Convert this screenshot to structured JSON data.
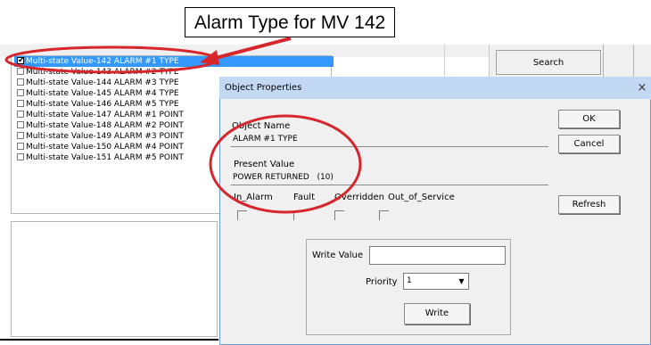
{
  "callout": {
    "text": "Alarm Type for MV 142"
  },
  "search": {
    "label": "Search"
  },
  "object_list": [
    {
      "label": "Multi-state Value-142 ALARM #1 TYPE",
      "checked": true,
      "selected": true
    },
    {
      "label": "Multi-state Value-143 ALARM #2 TYPE",
      "checked": false,
      "selected": false
    },
    {
      "label": "Multi-state Value-144 ALARM #3 TYPE",
      "checked": false,
      "selected": false
    },
    {
      "label": "Multi-state Value-145 ALARM #4 TYPE",
      "checked": false,
      "selected": false
    },
    {
      "label": "Multi-state Value-146 ALARM #5 TYPE",
      "checked": false,
      "selected": false
    },
    {
      "label": "Multi-state Value-147 ALARM #1 POINT",
      "checked": false,
      "selected": false
    },
    {
      "label": "Multi-state Value-148 ALARM #2 POINT",
      "checked": false,
      "selected": false
    },
    {
      "label": "Multi-state Value-149 ALARM #3 POINT",
      "checked": false,
      "selected": false
    },
    {
      "label": "Multi-state Value-150 ALARM #4 POINT",
      "checked": false,
      "selected": false
    },
    {
      "label": "Multi-state Value-151 ALARM #5 POINT",
      "checked": false,
      "selected": false
    }
  ],
  "dialog": {
    "title": "Object Properties",
    "close": "×",
    "object_name_label": "Object Name",
    "object_name_value": "ALARM #1 TYPE",
    "present_value_label": "Present Value",
    "present_value_value": "POWER RETURNED",
    "present_value_code": "(10)",
    "status_flags": [
      "In_Alarm",
      "Fault",
      "Overridden",
      "Out_of_Service"
    ],
    "ok_label": "OK",
    "cancel_label": "Cancel",
    "refresh_label": "Refresh",
    "write_value_label": "Write Value",
    "write_value_input": "",
    "priority_label": "Priority",
    "priority_value": "1",
    "write_button_label": "Write"
  },
  "colors": {
    "annotation": "#d6252b",
    "selection": "#3399ff",
    "title_bar": "#c3d9f3"
  },
  "icons": {
    "dropdown": "chevron-down-icon",
    "close": "close-icon",
    "check": "check-icon"
  }
}
